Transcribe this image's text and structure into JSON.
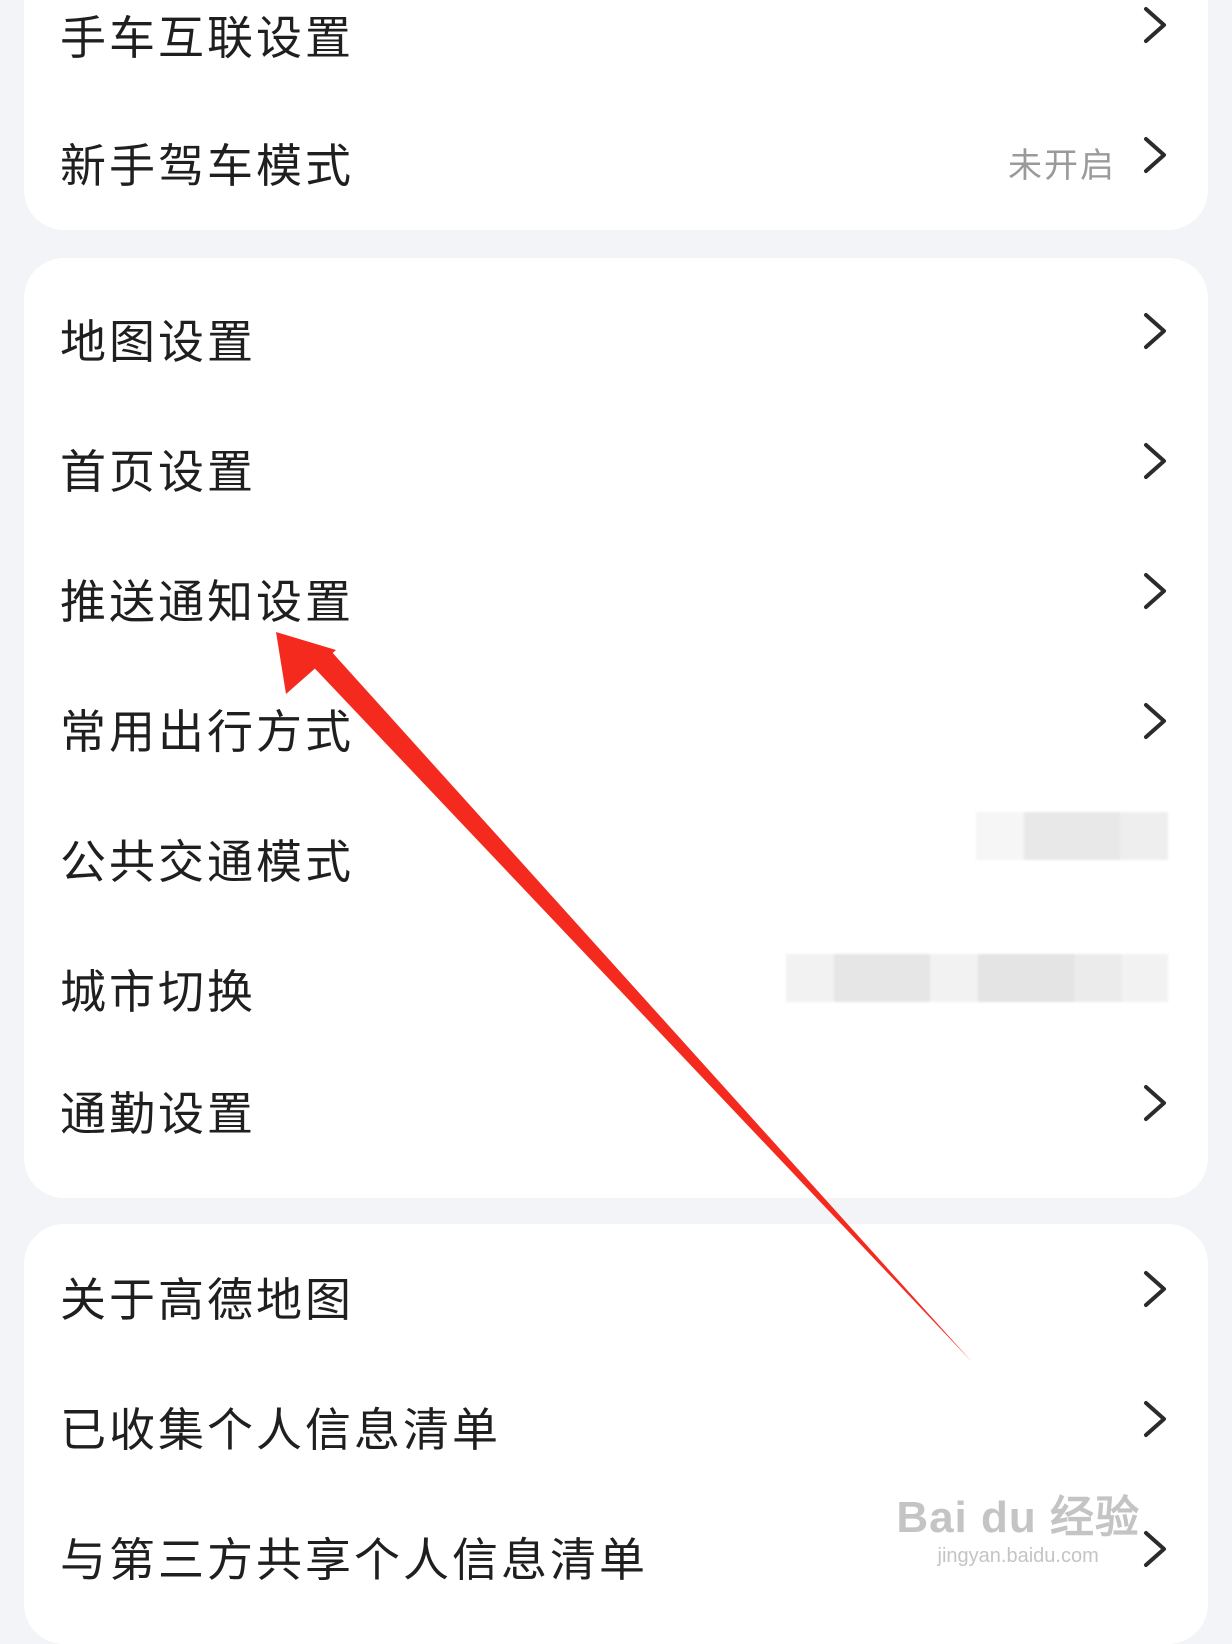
{
  "group1": {
    "items": [
      {
        "label": "手车互联设置",
        "value": ""
      },
      {
        "label": "新手驾车模式",
        "value": "未开启"
      }
    ]
  },
  "group2": {
    "items": [
      {
        "label": "地图设置"
      },
      {
        "label": "首页设置"
      },
      {
        "label": "推送通知设置"
      },
      {
        "label": "常用出行方式"
      },
      {
        "label": "公共交通模式"
      },
      {
        "label": "城市切换"
      },
      {
        "label": "通勤设置"
      }
    ]
  },
  "group3": {
    "items": [
      {
        "label": "关于高德地图"
      },
      {
        "label": "已收集个人信息清单"
      },
      {
        "label": "与第三方共享个人信息清单"
      }
    ]
  },
  "annotation": {
    "arrow_color": "#f52a1f"
  },
  "watermark": {
    "logo": "Bai du 经验",
    "url": "jingyan.baidu.com"
  },
  "colors": {
    "background": "#f3f4f7",
    "card": "#ffffff",
    "text": "#1f1f1f",
    "secondary_text": "#9a9a9a",
    "chevron": "#2b2b2b"
  }
}
